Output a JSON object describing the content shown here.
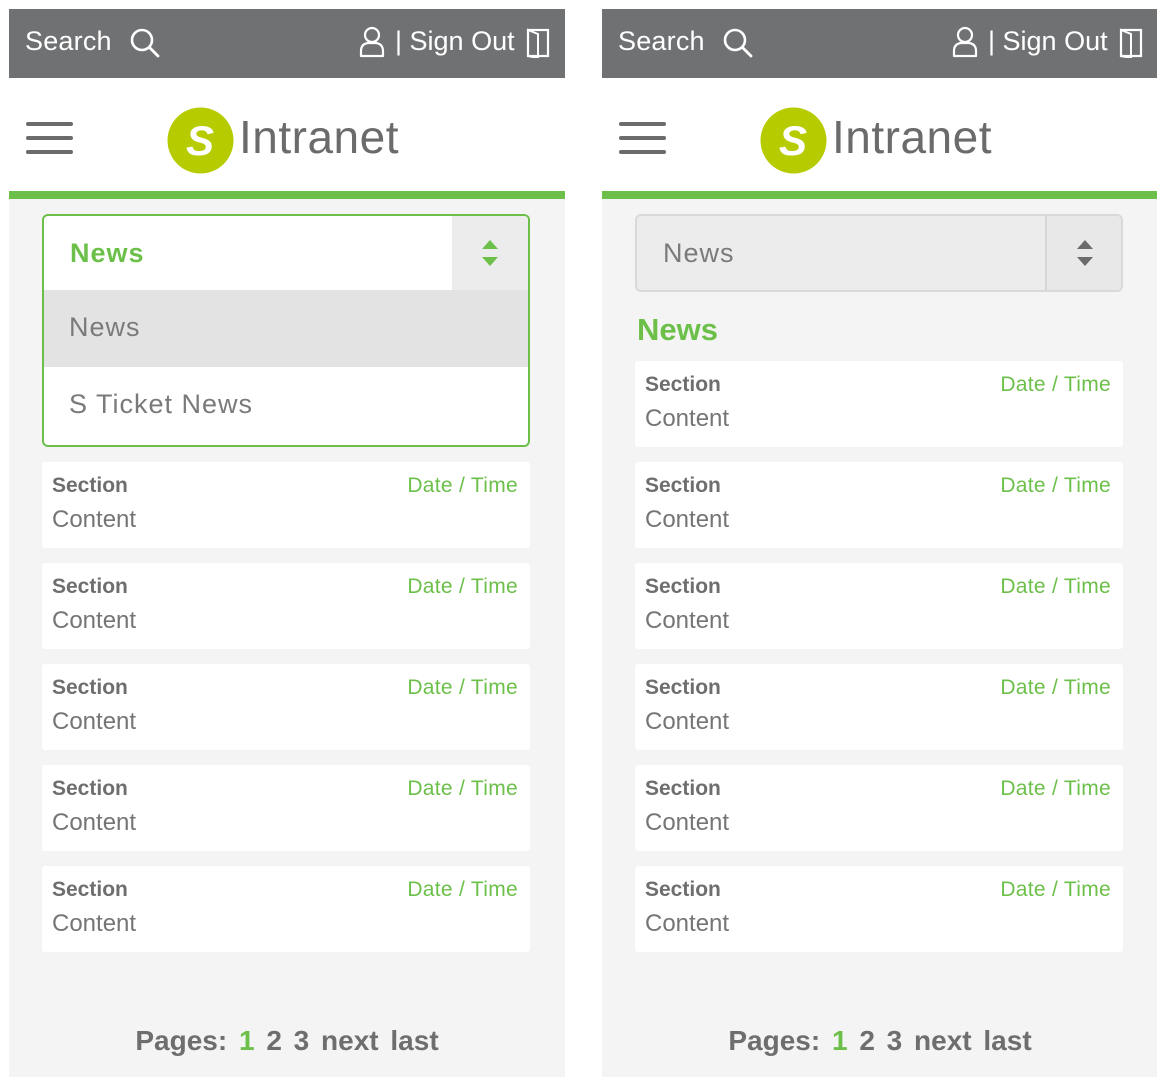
{
  "top_bar": {
    "search_label": "Search",
    "separator": "|",
    "signout_label": "Sign Out",
    "icons": [
      "search-icon",
      "user-icon",
      "sign-out-door-icon"
    ]
  },
  "header": {
    "logo_letter": "S",
    "logo_text": "Intranet",
    "menu_icon": "hamburger-menu-icon"
  },
  "colors": {
    "accent_green": "#6cc04a",
    "logo_lime": "#b7cc00",
    "top_bar_gray": "#707173",
    "text_gray": "#6e6e6e",
    "panel_bg": "#f4f4f4"
  },
  "category_select": {
    "value": "News",
    "options": [
      "News",
      "S Ticket News"
    ]
  },
  "category_title": "News",
  "news_items": [
    {
      "section": "Section",
      "date_time": "Date / Time",
      "content": "Content"
    },
    {
      "section": "Section",
      "date_time": "Date / Time",
      "content": "Content"
    },
    {
      "section": "Section",
      "date_time": "Date / Time",
      "content": "Content"
    },
    {
      "section": "Section",
      "date_time": "Date / Time",
      "content": "Content"
    },
    {
      "section": "Section",
      "date_time": "Date / Time",
      "content": "Content"
    }
  ],
  "left_screen_items": [
    {
      "section": "Section",
      "date_time": "Date / Time",
      "content": "Content"
    },
    {
      "section": "Section",
      "date_time": "Date / Time",
      "content": "Content"
    },
    {
      "section": "Section",
      "date_time": "Date / Time",
      "content": "Content"
    },
    {
      "section": "Section",
      "date_time": "Date / Time",
      "content": "Content"
    },
    {
      "section": "Section",
      "date_time": "Date / Time",
      "content": "Content"
    }
  ],
  "right_screen_items": [
    {
      "section": "Section",
      "date_time": "Date / Time",
      "content": "Content"
    },
    {
      "section": "Section",
      "date_time": "Date / Time",
      "content": "Content"
    },
    {
      "section": "Section",
      "date_time": "Date / Time",
      "content": "Content"
    },
    {
      "section": "Section",
      "date_time": "Date / Time",
      "content": "Content"
    },
    {
      "section": "Section",
      "date_time": "Date / Time",
      "content": "Content"
    },
    {
      "section": "Section",
      "date_time": "Date / Time",
      "content": "Content"
    }
  ],
  "pagination": {
    "label": "Pages:",
    "current": "1",
    "pages": [
      "2",
      "3"
    ],
    "next": "next",
    "last": "last"
  }
}
